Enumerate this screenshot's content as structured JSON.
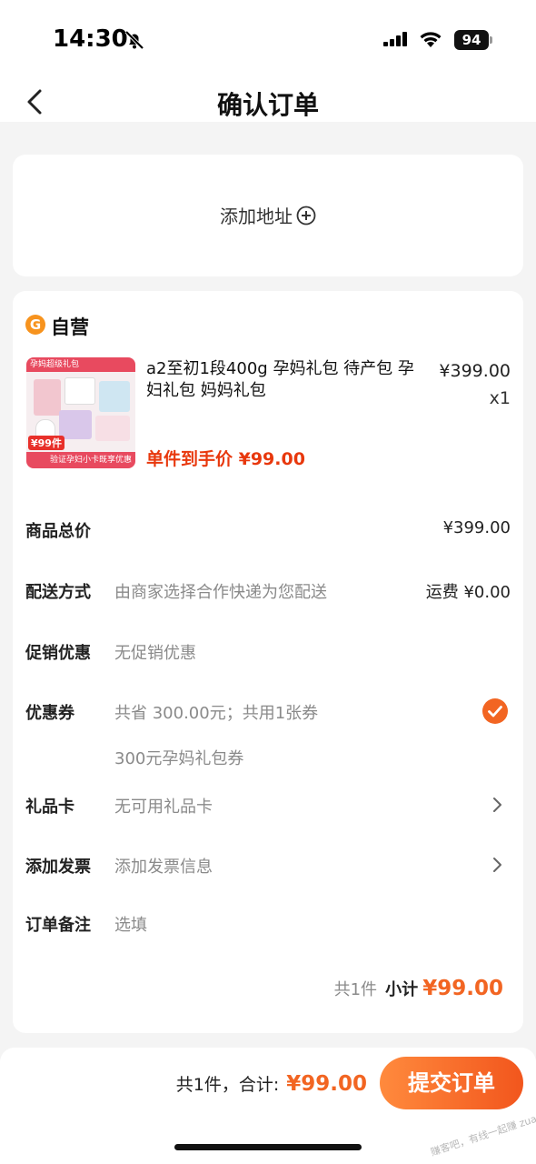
{
  "status_bar": {
    "time": "14:30",
    "battery": "94"
  },
  "nav": {
    "title": "确认订单"
  },
  "address": {
    "add_label": "添加地址"
  },
  "shop": {
    "name": "自营",
    "logo_text": "G"
  },
  "product": {
    "title": "a2至初1段400g 孕妈礼包 待产包 孕妇礼包 妈妈礼包",
    "price": "¥399.00",
    "quantity": "x1",
    "unit_price": "单件到手价 ¥99.00",
    "image_banner": "孕妈超级礼包",
    "image_price_tag": "¥99件",
    "image_strip": "验证孕妇小卡既享优惠"
  },
  "rows": {
    "total_goods": {
      "label": "商品总价",
      "right": "¥399.00"
    },
    "delivery": {
      "label": "配送方式",
      "value": "由商家选择合作快递为您配送",
      "right": "运费 ¥0.00"
    },
    "promotion": {
      "label": "促销优惠",
      "value": "无促销优惠"
    },
    "coupon": {
      "label": "优惠券",
      "value": "共省 300.00元；共用1张券",
      "detail": "300元孕妈礼包券"
    },
    "gift_card": {
      "label": "礼品卡",
      "value": "无可用礼品卡"
    },
    "invoice": {
      "label": "添加发票",
      "value": "添加发票信息"
    },
    "note": {
      "label": "订单备注",
      "placeholder": "选填"
    }
  },
  "subtotal": {
    "count": "共1件",
    "label": "小计",
    "amount": "¥99.00"
  },
  "bottom": {
    "total_label": "共1件，合计:",
    "total_amount": "¥99.00",
    "submit_label": "提交订单",
    "watermark": "赚客吧，有线一起赚 zuanke8.com"
  },
  "colors": {
    "accent": "#f26522",
    "price_red": "#e8380d",
    "check": "#f26522"
  }
}
